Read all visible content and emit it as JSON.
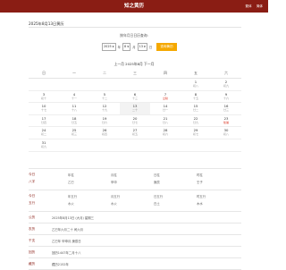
{
  "header": {
    "title": "知之黄历",
    "links": [
      "繁体",
      "简体"
    ]
  },
  "section_title": "2025年8月13日黄历",
  "query": {
    "label": "按年月日日历查询:",
    "year": "2025",
    "year_unit": "年",
    "month": "8",
    "month_unit": "月",
    "day": "13",
    "day_unit": "日",
    "button": "查询黄历"
  },
  "calendar_nav": "上一月 2025年8月 下一月",
  "weekdays": [
    "日",
    "一",
    "二",
    "三",
    "四",
    "五",
    "六"
  ],
  "weeks": [
    [
      {
        "d": "",
        "l": ""
      },
      {
        "d": "",
        "l": ""
      },
      {
        "d": "",
        "l": ""
      },
      {
        "d": "",
        "l": ""
      },
      {
        "d": "",
        "l": ""
      },
      {
        "d": "1",
        "l": "初八"
      },
      {
        "d": "2",
        "l": "初九"
      }
    ],
    [
      {
        "d": "3",
        "l": "初十"
      },
      {
        "d": "4",
        "l": "十一"
      },
      {
        "d": "5",
        "l": "十二"
      },
      {
        "d": "6",
        "l": "十三"
      },
      {
        "d": "7",
        "l": "立秋"
      },
      {
        "d": "8",
        "l": "十五"
      },
      {
        "d": "9",
        "l": "十六"
      }
    ],
    [
      {
        "d": "10",
        "l": "十七"
      },
      {
        "d": "11",
        "l": "十八"
      },
      {
        "d": "12",
        "l": "十九"
      },
      {
        "d": "13",
        "l": "二十"
      },
      {
        "d": "14",
        "l": "廿一"
      },
      {
        "d": "15",
        "l": "廿二"
      },
      {
        "d": "16",
        "l": "廿三"
      }
    ],
    [
      {
        "d": "17",
        "l": "廿四"
      },
      {
        "d": "18",
        "l": "廿五"
      },
      {
        "d": "19",
        "l": "廿六"
      },
      {
        "d": "20",
        "l": "廿七"
      },
      {
        "d": "21",
        "l": "廿八"
      },
      {
        "d": "22",
        "l": "廿九"
      },
      {
        "d": "23",
        "l": "处暑"
      }
    ],
    [
      {
        "d": "24",
        "l": "初二"
      },
      {
        "d": "25",
        "l": "初三"
      },
      {
        "d": "26",
        "l": "初四"
      },
      {
        "d": "27",
        "l": "初五"
      },
      {
        "d": "28",
        "l": "初六"
      },
      {
        "d": "29",
        "l": "初七"
      },
      {
        "d": "30",
        "l": "初八"
      }
    ],
    [
      {
        "d": "31",
        "l": "初九"
      },
      {
        "d": "",
        "l": ""
      },
      {
        "d": "",
        "l": ""
      },
      {
        "d": "",
        "l": ""
      },
      {
        "d": "",
        "l": ""
      },
      {
        "d": "",
        "l": ""
      },
      {
        "d": "",
        "l": ""
      }
    ]
  ],
  "red_labels": [
    "立秋",
    "处暑"
  ],
  "today_index": [
    2,
    3
  ],
  "pillars": {
    "top": {
      "label": "今日",
      "values": [
        "年柱",
        "月柱",
        "日柱",
        "时柱"
      ]
    },
    "bottom": {
      "label": "八字",
      "values": [
        "乙巳",
        "甲申",
        "庚辰",
        "壬子"
      ]
    }
  },
  "wuxing": {
    "top": {
      "label": "今日",
      "values": [
        "年五行",
        "月五行",
        "日五行",
        "时五行"
      ]
    },
    "bottom": {
      "label": "五行",
      "values": [
        "水火",
        "水火",
        "白土",
        "木水"
      ]
    }
  },
  "info_rows": [
    {
      "k": "公历",
      "v": "2025年8月13日 (大月) 星期三"
    },
    {
      "k": "农历",
      "v": "乙巳年六月二十 闰六月"
    },
    {
      "k": "干支",
      "v": "乙巳年 甲申月 庚辰日"
    },
    {
      "k": "回历",
      "v": "回历1447年二月十八"
    },
    {
      "k": "藏历",
      "v": "藏历2152年"
    }
  ]
}
